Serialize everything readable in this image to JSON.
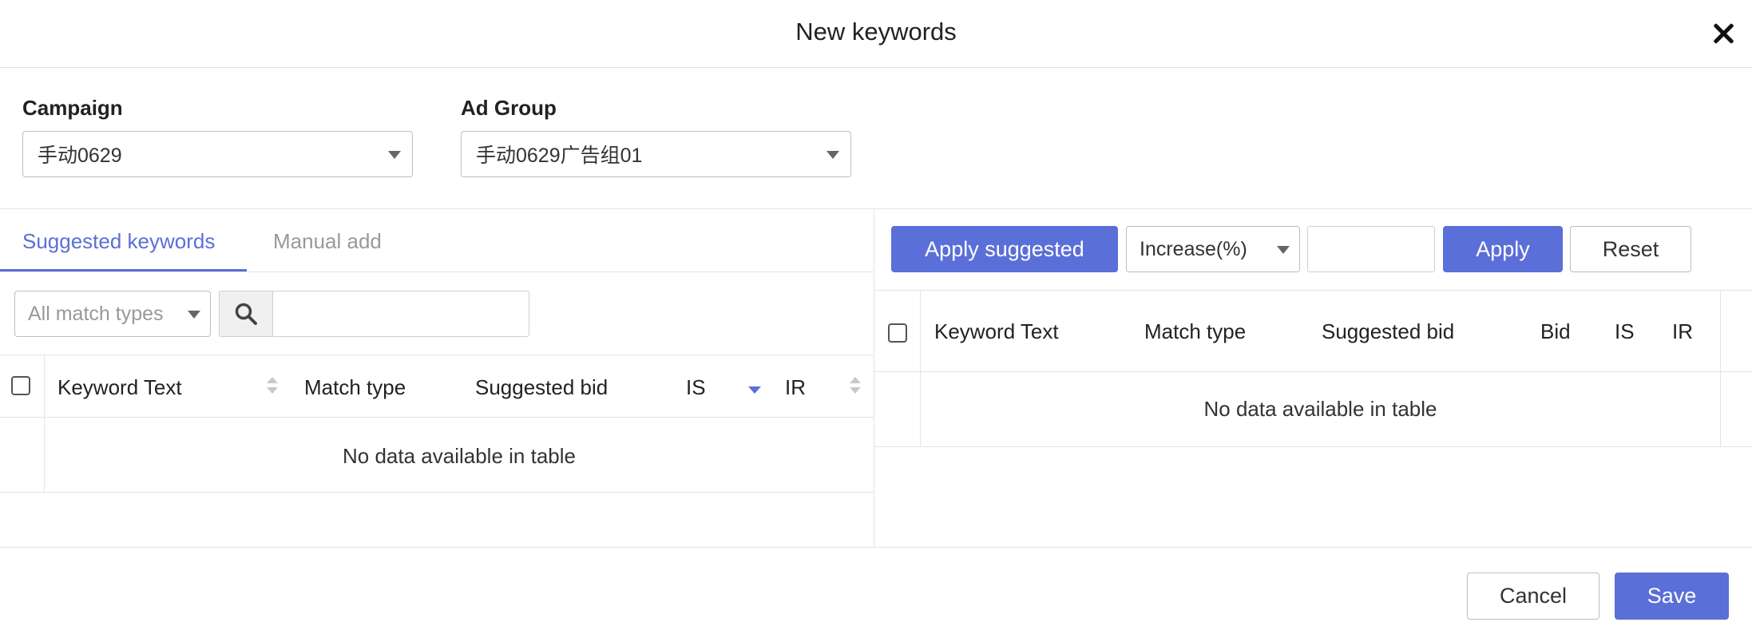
{
  "modal": {
    "title": "New keywords"
  },
  "filters": {
    "campaign_label": "Campaign",
    "campaign_value": "手动0629",
    "adgroup_label": "Ad Group",
    "adgroup_value": "手动0629广告组01"
  },
  "left_panel": {
    "tabs": [
      {
        "label": "Suggested keywords",
        "active": true
      },
      {
        "label": "Manual add",
        "active": false
      }
    ],
    "match_filter": "All match types",
    "search": {
      "placeholder": "",
      "value": ""
    },
    "columns": [
      "Keyword Text",
      "Match type",
      "Suggested bid",
      "IS",
      "IR"
    ],
    "empty_message": "No data available in table"
  },
  "right_panel": {
    "toolbar": {
      "apply_suggested": "Apply suggested",
      "adjust_mode": "Increase(%)",
      "adjust_value": "",
      "apply": "Apply",
      "reset": "Reset"
    },
    "columns": [
      "Keyword Text",
      "Match type",
      "Suggested bid",
      "Bid",
      "IS",
      "IR"
    ],
    "empty_message": "No data available in table"
  },
  "footer": {
    "cancel": "Cancel",
    "save": "Save"
  },
  "colors": {
    "primary": "#5a6fd8",
    "border": "#e4e4e4"
  },
  "icons": [
    "close-icon",
    "search-icon",
    "chevron-down-icon",
    "sort-icon",
    "sort-desc-icon"
  ]
}
